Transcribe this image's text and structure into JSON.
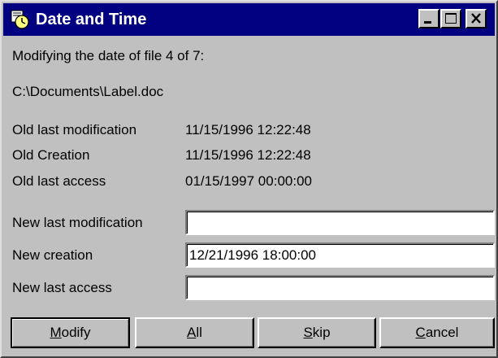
{
  "window": {
    "title": "Date and Time",
    "icon": "date-time-app-icon",
    "controls": [
      "minimize-icon",
      "maximize-icon",
      "close-icon"
    ]
  },
  "intro": "Modifying the date of file 4 of 7:",
  "file_path": "C:\\Documents\\Label.doc",
  "old": {
    "modification_label": "Old last modification",
    "modification_value": "11/15/1996 12:22:48",
    "creation_label": "Old Creation",
    "creation_value": "11/15/1996 12:22:48",
    "access_label": "Old last access",
    "access_value": "01/15/1997 00:00:00"
  },
  "new": {
    "modification_label": "New last modification",
    "modification_value": "",
    "creation_label": "New creation",
    "creation_value": "12/21/1996 18:00:00",
    "access_label": "New last access",
    "access_value": ""
  },
  "buttons": {
    "modify_u": "M",
    "modify_rest": "odify",
    "all_u": "A",
    "all_rest": "ll",
    "skip_u": "S",
    "skip_rest": "kip",
    "cancel_u": "C",
    "cancel_rest": "ancel"
  },
  "colors": {
    "titlebar": "#000080",
    "face": "#c0c0c0"
  }
}
